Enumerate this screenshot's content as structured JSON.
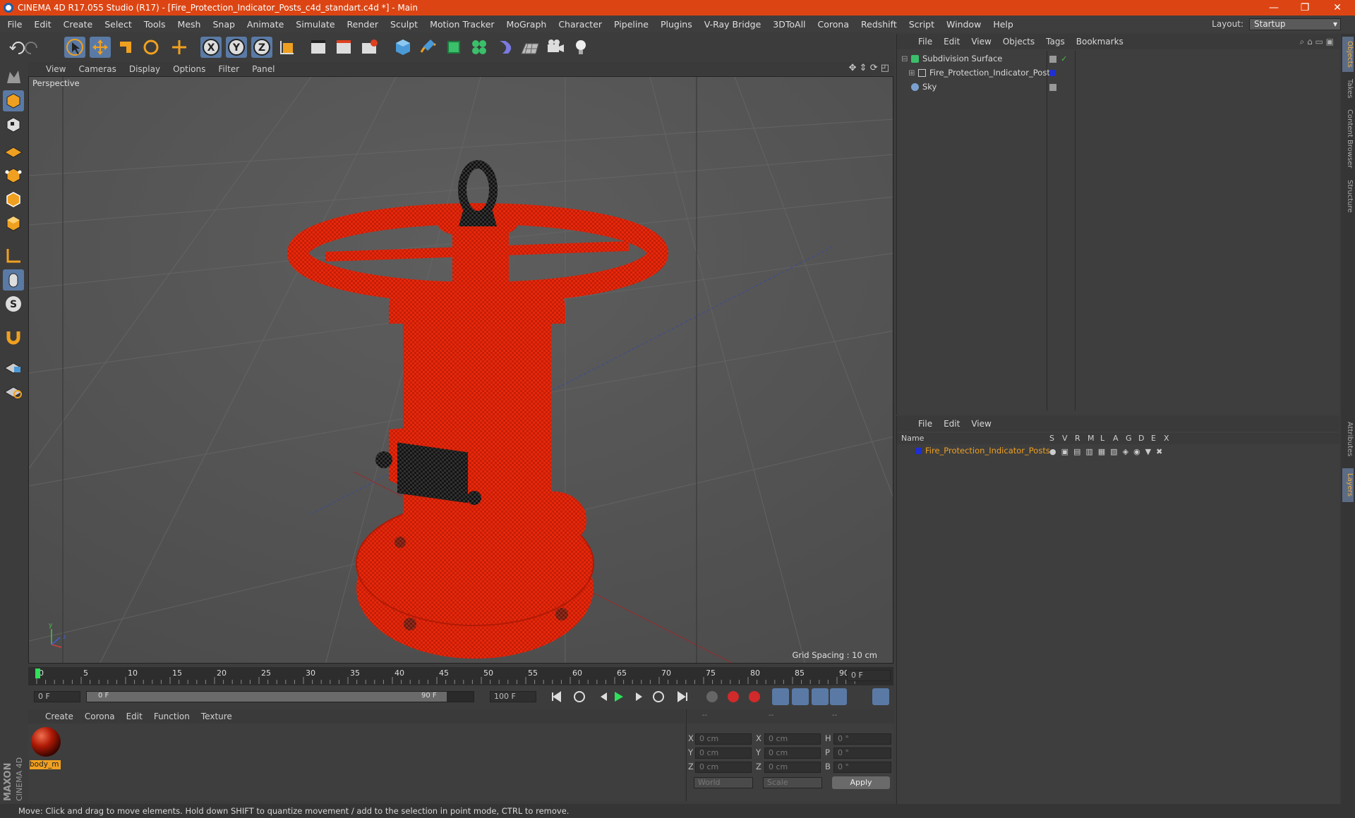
{
  "titlebar": {
    "title": "CINEMA 4D R17.055 Studio (R17) - [Fire_Protection_Indicator_Posts_c4d_standart.c4d *] - Main",
    "min": "—",
    "max": "❐",
    "close": "✕"
  },
  "menu": [
    "File",
    "Edit",
    "Create",
    "Select",
    "Tools",
    "Mesh",
    "Snap",
    "Animate",
    "Simulate",
    "Render",
    "Sculpt",
    "Motion Tracker",
    "MoGraph",
    "Character",
    "Pipeline",
    "Plugins",
    "V-Ray Bridge",
    "3DToAll",
    "Corona",
    "Redshift",
    "Script",
    "Window",
    "Help"
  ],
  "layout": {
    "label": "Layout:",
    "value": "Startup"
  },
  "viewport": {
    "menu": [
      "View",
      "Cameras",
      "Display",
      "Options",
      "Filter",
      "Panel"
    ],
    "label": "Perspective",
    "grid_spacing": "Grid Spacing : 10 cm"
  },
  "timeline": {
    "ticks": [
      "0",
      "5",
      "10",
      "15",
      "20",
      "25",
      "30",
      "35",
      "40",
      "45",
      "50",
      "55",
      "60",
      "65",
      "70",
      "75",
      "80",
      "85",
      "90"
    ],
    "current": "0 F",
    "start": "0 F",
    "range_start": "0 F",
    "range_end": "90 F",
    "end": "100 F"
  },
  "materials": {
    "menu": [
      "Create",
      "Corona",
      "Edit",
      "Function",
      "Texture"
    ],
    "items": [
      {
        "name": "body_m"
      }
    ]
  },
  "coords": {
    "header": [
      "--",
      "--",
      "--"
    ],
    "rows": [
      {
        "a": "X",
        "av": "0 cm",
        "b": "X",
        "bv": "0 cm",
        "c": "H",
        "cv": "0 °"
      },
      {
        "a": "Y",
        "av": "0 cm",
        "b": "Y",
        "bv": "0 cm",
        "c": "P",
        "cv": "0 °"
      },
      {
        "a": "Z",
        "av": "0 cm",
        "b": "Z",
        "bv": "0 cm",
        "c": "B",
        "cv": "0 °"
      }
    ],
    "world": "World",
    "scale": "Scale",
    "apply": "Apply"
  },
  "objects": {
    "menu": [
      "File",
      "Edit",
      "View",
      "Objects",
      "Tags",
      "Bookmarks"
    ],
    "items": [
      {
        "name": "Subdivision Surface"
      },
      {
        "name": "Fire_Protection_Indicator_Posts"
      },
      {
        "name": "Sky"
      }
    ]
  },
  "layers": {
    "menu": [
      "File",
      "Edit",
      "View"
    ],
    "header": {
      "name": "Name",
      "cols": [
        "S",
        "V",
        "R",
        "M",
        "L",
        "A",
        "G",
        "D",
        "E",
        "X"
      ]
    },
    "items": [
      {
        "name": "Fire_Protection_Indicator_Posts"
      }
    ]
  },
  "righttabs": [
    "Objects",
    "Takes",
    "Content Browser",
    "Structure",
    "Attributes",
    "Layers"
  ],
  "status": "Move: Click and drag to move elements. Hold down SHIFT to quantize movement / add to the selection in point mode, CTRL to remove.",
  "colors": {
    "title": "#dc4513",
    "accent": "#f0a020",
    "model": "#e0280c",
    "selected": "#5a7aa5"
  }
}
